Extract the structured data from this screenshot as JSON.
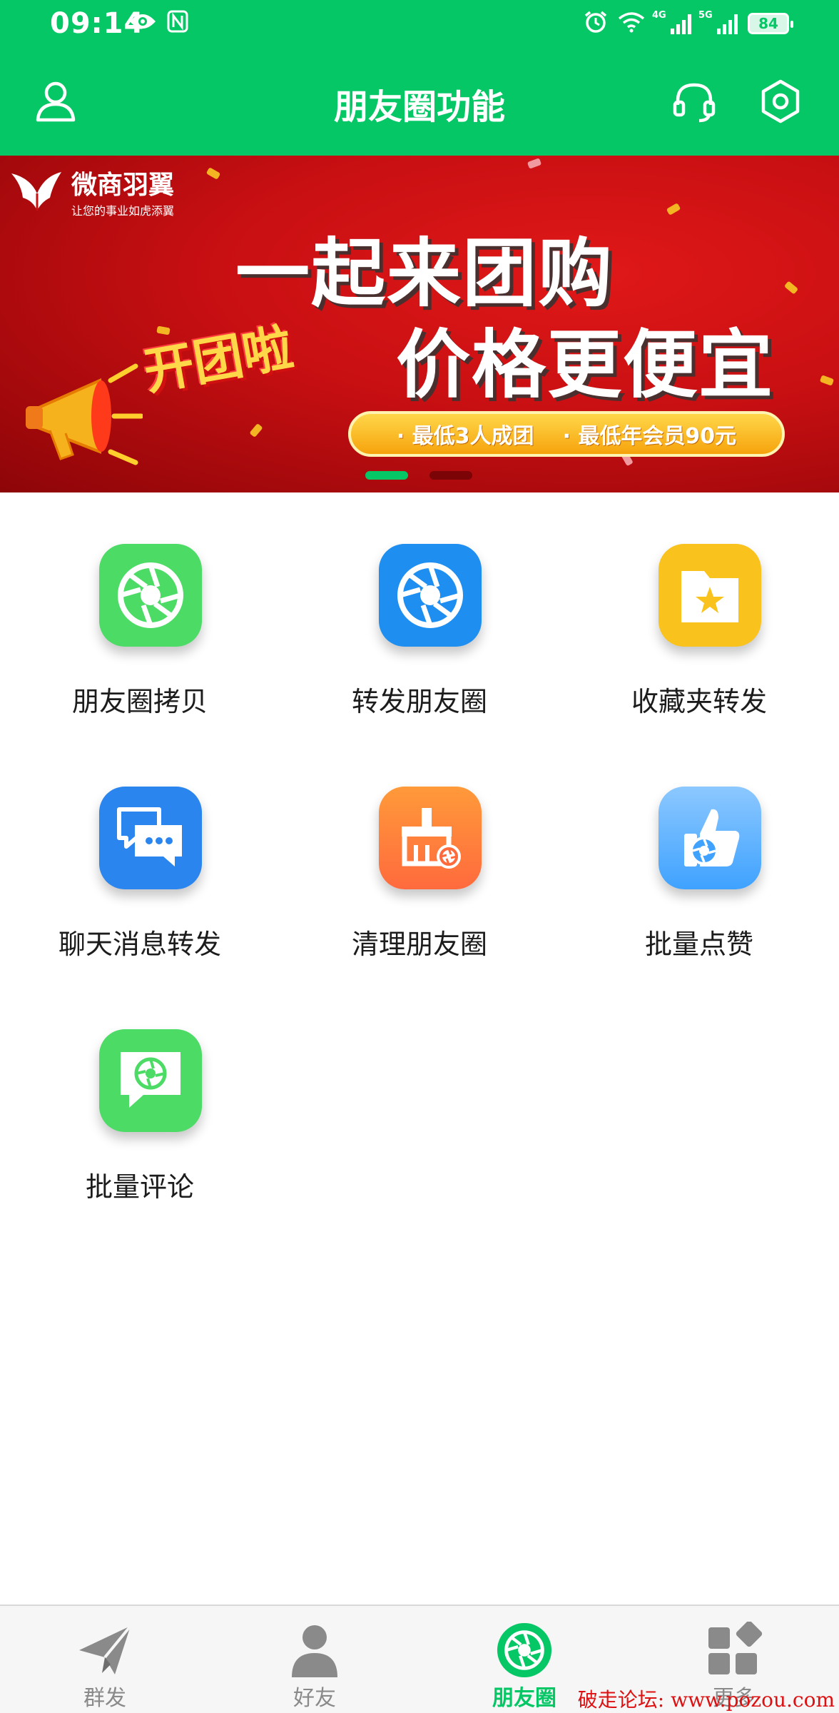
{
  "status_bar": {
    "time": "09:14",
    "left_icons": [
      "eye-icon",
      "nfc-icon"
    ],
    "right_icons": [
      "alarm-icon",
      "wifi-icon",
      "signal-4g-icon",
      "signal-5g-icon"
    ],
    "signal1_label": "4G",
    "signal2_label": "5G",
    "battery": "84"
  },
  "header": {
    "title": "朋友圈功能",
    "left_icon": "user-icon",
    "right_icons": [
      "headset-icon",
      "settings-hex-icon"
    ],
    "background": "#05c766"
  },
  "banner": {
    "brand_name": "微商羽翼",
    "brand_slogan": "让您的事业如虎添翼",
    "headline1": "一起来团购",
    "headline2": "价格更便宜",
    "sticker": "开团啦",
    "pill_item1": "· 最低3人成团",
    "pill_item2": "· 最低年会员90元",
    "slide_count": 2,
    "active_slide": 1
  },
  "features": [
    {
      "label": "朋友圈拷贝",
      "icon": "camera-aperture-icon",
      "color": "#4cdc66"
    },
    {
      "label": "转发朋友圈",
      "icon": "camera-aperture-icon",
      "color": "#1e8ff0"
    },
    {
      "label": "收藏夹转发",
      "icon": "star-folder-icon",
      "color": "#f9c21c"
    },
    {
      "label": "聊天消息转发",
      "icon": "chat-bubbles-icon",
      "color": "#2b85ee"
    },
    {
      "label": "清理朋友圈",
      "icon": "broom-icon",
      "color": "#ff7a3a"
    },
    {
      "label": "批量点赞",
      "icon": "thumbs-up-icon",
      "color": "#4aa7ff"
    },
    {
      "label": "批量评论",
      "icon": "comment-bubble-icon",
      "color": "#4cdc66"
    }
  ],
  "bottom_nav": {
    "items": [
      {
        "label": "群发",
        "icon": "paper-plane-icon"
      },
      {
        "label": "好友",
        "icon": "person-icon"
      },
      {
        "label": "朋友圈",
        "icon": "camera-aperture-icon"
      },
      {
        "label": "更多",
        "icon": "grid-more-icon"
      }
    ],
    "active_index": 2,
    "active_color": "#05c766"
  },
  "watermark": "破走论坛: www.pozou.com"
}
